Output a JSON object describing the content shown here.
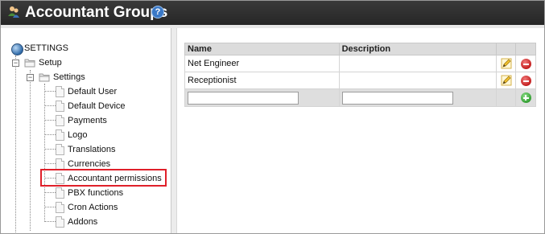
{
  "header": {
    "title": "Accountant Groups",
    "app_icon": "users-icon",
    "help_icon": "help-icon",
    "help_glyph": "?"
  },
  "tree": {
    "root": {
      "label": "SETTINGS",
      "icon": "globe-icon"
    },
    "setup": {
      "label": "Setup",
      "toggle": "−",
      "icon": "folder-icon"
    },
    "settings": {
      "label": "Settings",
      "toggle": "−",
      "icon": "folder-icon"
    },
    "items": [
      "Default User",
      "Default Device",
      "Payments",
      "Logo",
      "Translations",
      "Currencies",
      "Accountant permissions",
      "PBX functions",
      "Cron Actions",
      "Addons"
    ],
    "highlighted": "Accountant permissions",
    "highlight_color": "#e0202a"
  },
  "grid": {
    "columns": [
      "Name",
      "Description",
      "",
      ""
    ],
    "rows": [
      {
        "name": "Net Engineer",
        "description": "",
        "edit_icon": "pencil-icon",
        "delete_icon": "delete-icon"
      },
      {
        "name": "Receptionist",
        "description": "",
        "edit_icon": "pencil-icon",
        "delete_icon": "delete-icon"
      }
    ],
    "new_row": {
      "name_value": "",
      "description_value": "",
      "add_icon": "add-icon"
    }
  },
  "colors": {
    "header_bg": "#2e2e2e",
    "header_text": "#ffffff",
    "table_header_bg": "#dcdcdc",
    "new_row_bg": "#dedede",
    "delete": "#c01818",
    "add": "#2c9a2c"
  }
}
